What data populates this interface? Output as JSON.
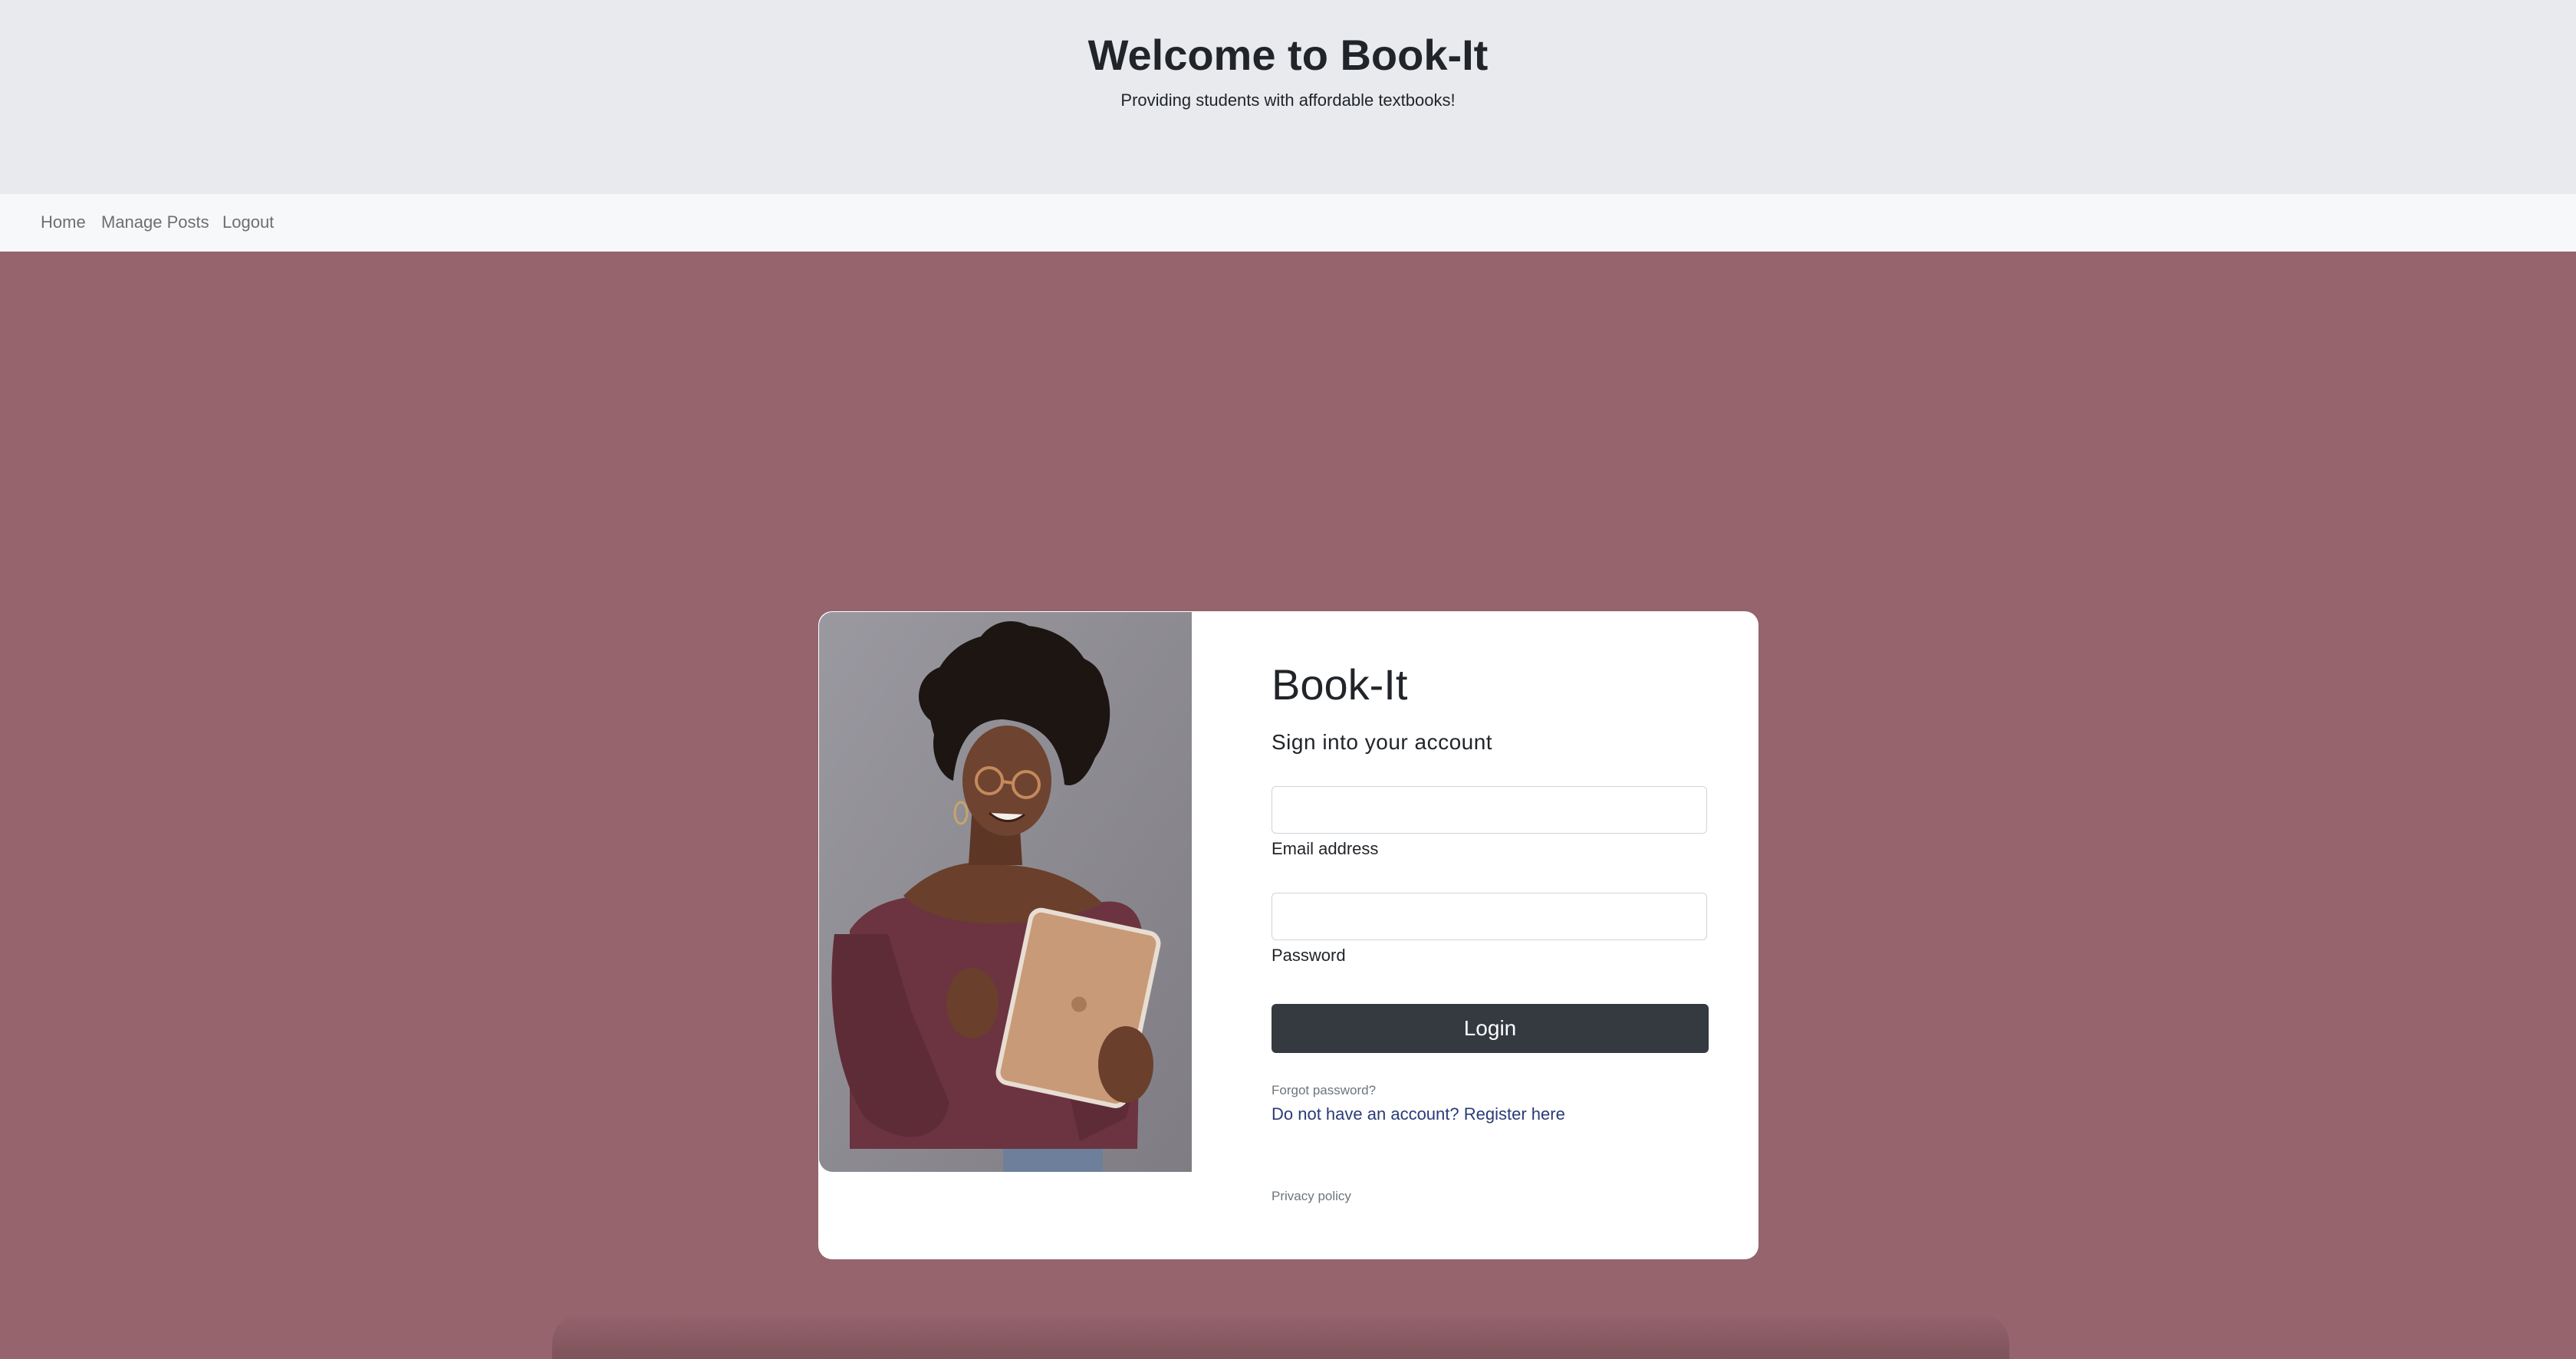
{
  "header": {
    "title": "Welcome to Book-It",
    "tagline": "Providing students with affordable textbooks!"
  },
  "nav": {
    "items": [
      {
        "label": "Home"
      },
      {
        "label": "Manage Posts"
      },
      {
        "label": "Logout"
      }
    ]
  },
  "login_card": {
    "brand": "Book-It",
    "subtitle": "Sign into your account",
    "email": {
      "label": "Email address",
      "value": "",
      "placeholder": ""
    },
    "password": {
      "label": "Password",
      "value": "",
      "placeholder": ""
    },
    "login_button": "Login",
    "forgot_link": "Forgot password?",
    "register_link": "Do not have an account? Register here",
    "privacy_link": "Privacy policy",
    "image_icon": "woman-with-tablet-photo"
  },
  "colors": {
    "header_bg": "#e9eaee",
    "nav_bg": "#f7f8fa",
    "page_bg": "#95646d",
    "button_bg": "#343a40",
    "link_color": "#2b3a78"
  }
}
